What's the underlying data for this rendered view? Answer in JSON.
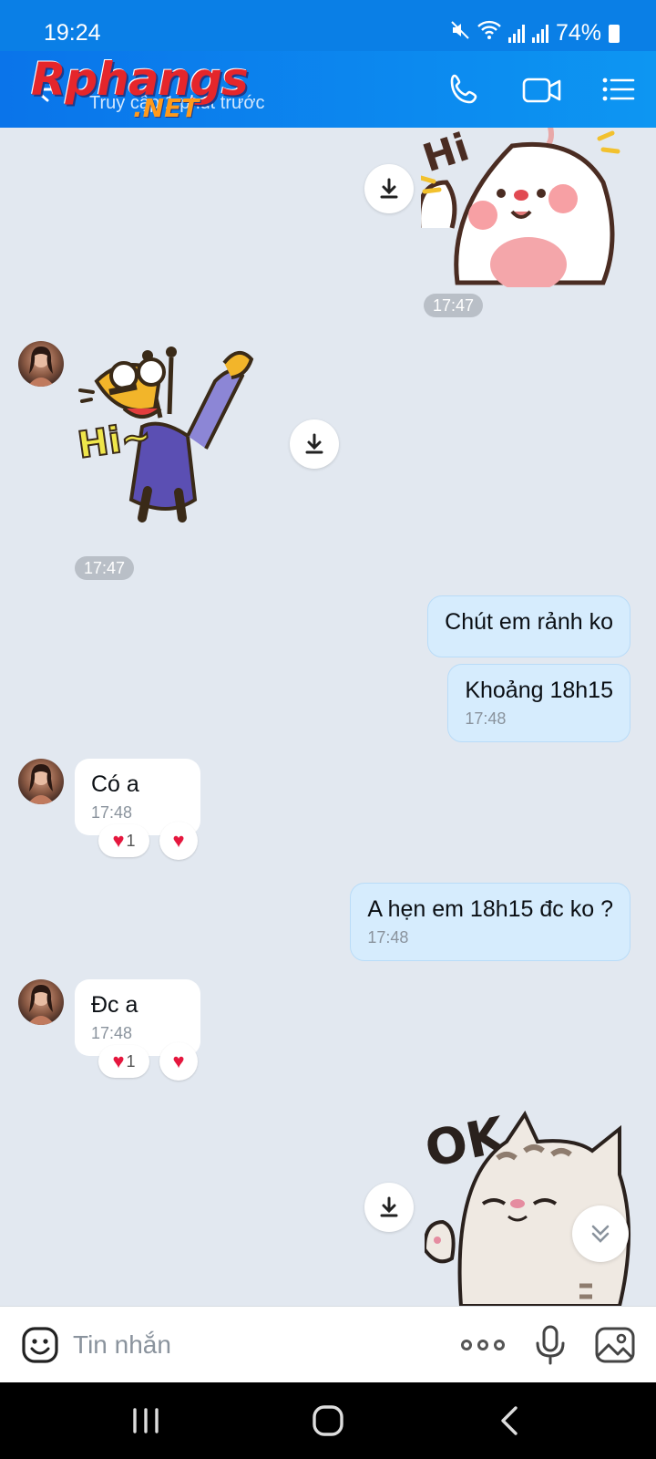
{
  "status_bar": {
    "time": "19:24",
    "battery": "74%"
  },
  "header": {
    "logo_main": "Rphangs",
    "logo_suffix": ".NET",
    "subtitle": "Truy cập 1 phút trước"
  },
  "messages": [
    {
      "type": "sticker",
      "side": "out",
      "sticker_name": "hi-bunny-sticker",
      "time": "17:47"
    },
    {
      "type": "sticker",
      "side": "in",
      "sticker_name": "hi-giraffe-sticker",
      "time": "17:47"
    },
    {
      "type": "text",
      "side": "out",
      "text": "Chút em rảnh ko"
    },
    {
      "type": "text",
      "side": "out",
      "text": "Khoảng 18h15",
      "time": "17:48"
    },
    {
      "type": "text",
      "side": "in",
      "text": "Có a",
      "time": "17:48",
      "reaction_count": "1"
    },
    {
      "type": "text",
      "side": "out",
      "text": "A hẹn em 18h15 đc ko ?",
      "time": "17:48"
    },
    {
      "type": "text",
      "side": "in",
      "text": "Đc a",
      "time": "17:48",
      "reaction_count": "1"
    },
    {
      "type": "sticker",
      "side": "out",
      "sticker_name": "ok-cat-sticker",
      "sticker_text": "OK"
    }
  ],
  "input_bar": {
    "placeholder": "Tin nhắn"
  },
  "icons": {
    "header": [
      "back-arrow-icon",
      "phone-icon",
      "video-call-icon",
      "menu-list-icon"
    ],
    "input": [
      "emoji-icon",
      "more-icon",
      "microphone-icon",
      "image-icon"
    ],
    "nav": [
      "recents-icon",
      "home-icon",
      "back-icon"
    ]
  },
  "colors": {
    "header": "#0a7fe6",
    "chat_bg": "#e2e8f0",
    "outgoing_bubble": "#d6ecfd",
    "incoming_bubble": "#ffffff",
    "heart": "#e5173e"
  }
}
